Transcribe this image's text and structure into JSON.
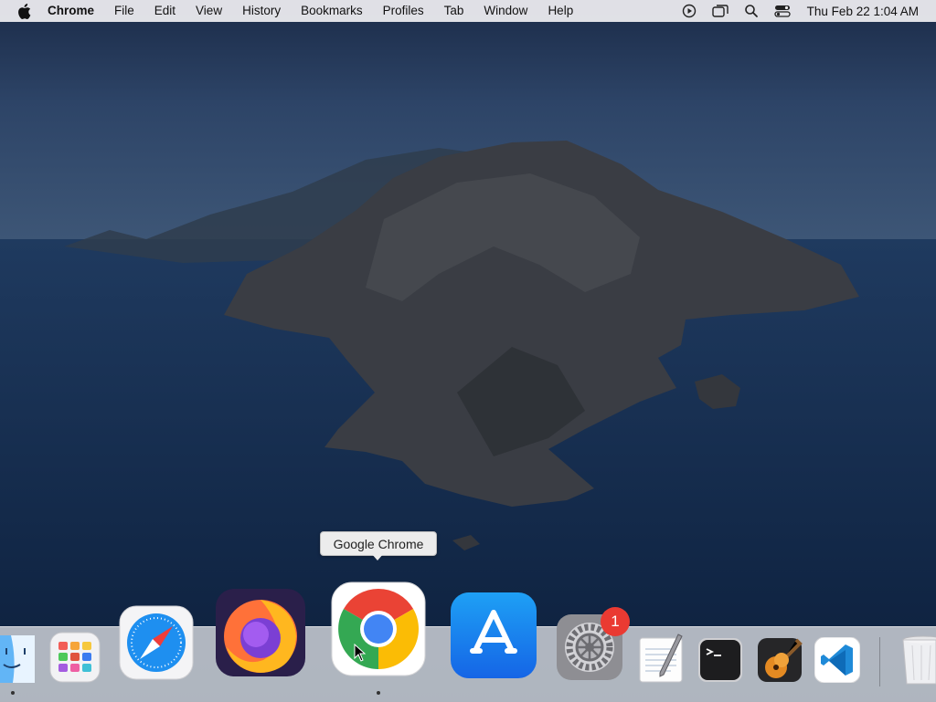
{
  "menubar": {
    "apple_icon": "apple-logo-icon",
    "app_name": "Chrome",
    "items": [
      "File",
      "Edit",
      "View",
      "History",
      "Bookmarks",
      "Profiles",
      "Tab",
      "Window",
      "Help"
    ],
    "status_icons": [
      "play-circle-icon",
      "screen-mirroring-icon",
      "search-icon",
      "control-center-icon"
    ],
    "clock": "Thu Feb 22  1:04 AM"
  },
  "tooltip": {
    "text": "Google Chrome"
  },
  "dock": {
    "apps": [
      {
        "name": "Finder",
        "icon": "finder-icon",
        "running": true
      },
      {
        "name": "Launchpad",
        "icon": "launchpad-icon",
        "running": false
      },
      {
        "name": "Safari",
        "icon": "safari-compass-icon",
        "running": false
      },
      {
        "name": "Firefox",
        "icon": "firefox-icon",
        "running": false
      },
      {
        "name": "Google Chrome",
        "icon": "chrome-icon",
        "running": true
      },
      {
        "name": "App Store",
        "icon": "app-store-icon",
        "running": false
      },
      {
        "name": "System Preferences",
        "icon": "gear-icon",
        "running": false,
        "badge": "1"
      },
      {
        "name": "TextEdit",
        "icon": "textedit-icon",
        "running": false
      },
      {
        "name": "Terminal",
        "icon": "terminal-icon",
        "running": false
      },
      {
        "name": "GarageBand",
        "icon": "guitar-icon",
        "running": false
      },
      {
        "name": "Visual Studio Code",
        "icon": "vscode-icon",
        "running": false
      },
      {
        "name": "Trash",
        "icon": "trash-icon",
        "running": false
      }
    ]
  },
  "colors": {
    "badge": "#ea3a32",
    "menubar": "#e8e8ec",
    "dock": "#dee0e4"
  }
}
